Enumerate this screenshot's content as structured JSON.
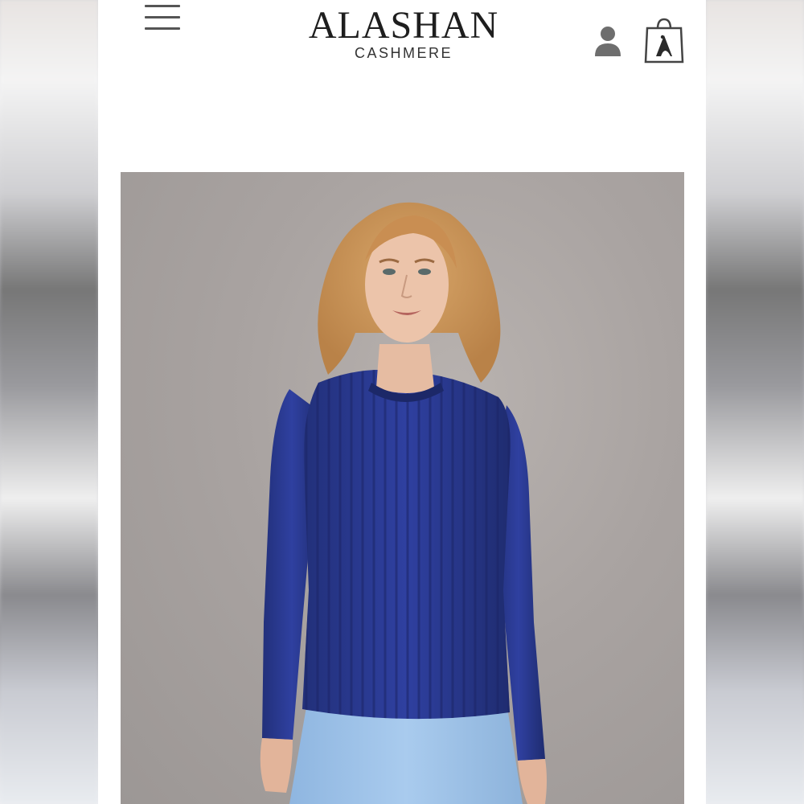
{
  "header": {
    "brand_name": "ALASHAN",
    "brand_subtitle": "CASHMERE",
    "menu_icon": "hamburger-menu-icon",
    "account_icon": "user-icon",
    "cart_icon": "shopping-bag-icon"
  },
  "product": {
    "image_subject": "model-wearing-navy-ribbed-cashmere-sweater",
    "colors": {
      "background": "#a9a3a1",
      "sweater": "#2b3a8f",
      "jeans": "#9fc3e6",
      "hair": "#c9935a"
    }
  }
}
